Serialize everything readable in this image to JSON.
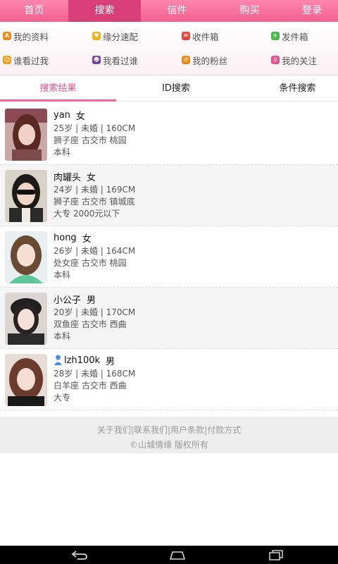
{
  "nav": {
    "items": [
      {
        "label": "首页"
      },
      {
        "label": "搜索"
      },
      {
        "label": "信件"
      },
      {
        "label": "购买"
      },
      {
        "label": "登录"
      }
    ],
    "active_index": 1,
    "color_active": "#d83f76"
  },
  "quick_menu": {
    "items": [
      {
        "label": "我的资料",
        "icon": "profile-icon",
        "color": "#f08a1a"
      },
      {
        "label": "缘分速配",
        "icon": "match-icon",
        "color": "#f0b41a"
      },
      {
        "label": "收件箱",
        "icon": "inbox-icon",
        "color": "#e8453c"
      },
      {
        "label": "发件箱",
        "icon": "outbox-icon",
        "color": "#4cb848"
      },
      {
        "label": "谁看过我",
        "icon": "visitors-icon",
        "color": "#f0a020"
      },
      {
        "label": "我看过谁",
        "icon": "viewed-icon",
        "color": "#7a3d9a"
      },
      {
        "label": "我的粉丝",
        "icon": "fans-icon",
        "color": "#f08a1a"
      },
      {
        "label": "我的关注",
        "icon": "follow-icon",
        "color": "#e8508a"
      }
    ]
  },
  "tabs": {
    "items": [
      {
        "label": "搜索结果"
      },
      {
        "label": "ID搜索"
      },
      {
        "label": "条件搜索"
      }
    ],
    "active_index": 0
  },
  "results": [
    {
      "name": "yan",
      "sex": "女",
      "line1": "25岁 | 未婚 | 160CM",
      "line2": "狮子座 古交市 桃园",
      "line3": "本科",
      "vip": false
    },
    {
      "name": "肉罐头",
      "sex": "女",
      "line1": "24岁 | 未婚 | 169CM",
      "line2": "狮子座 古交市 镇城底",
      "line3": "大专 2000元以下",
      "vip": false
    },
    {
      "name": "hong",
      "sex": "女",
      "line1": "26岁 | 未婚 | 164CM",
      "line2": "处女座 古交市 桃园",
      "line3": "本科",
      "vip": false
    },
    {
      "name": "小公子",
      "sex": "男",
      "line1": "20岁 | 未婚 | 170CM",
      "line2": "双鱼座 古交市 西曲",
      "line3": "本科",
      "vip": false
    },
    {
      "name": "lzh100k",
      "sex": "男",
      "line1": "28岁 | 未婚 | 168CM",
      "line2": "白羊座 古交市 西曲",
      "line3": "大专",
      "vip": true
    }
  ],
  "footer": {
    "links": [
      "关于我们",
      "联系我们",
      "用户条款",
      "付款方式"
    ],
    "separator": " | ",
    "copyright": "©山城情缘 版权所有"
  },
  "colors": {
    "accent": "#e8508a",
    "nav_gradient_top": "#ff86b0",
    "nav_gradient_bottom": "#f2608f"
  }
}
